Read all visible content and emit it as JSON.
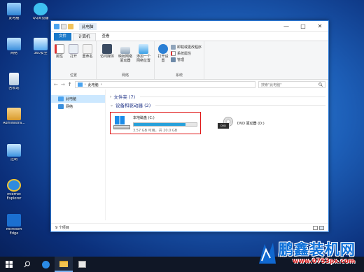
{
  "desktop": {
    "icons": [
      {
        "label": "此电脑",
        "color": "#4aa3ef"
      },
      {
        "label": "QQ浏览器",
        "color": "#3ec1f0"
      },
      {
        "label": "网络",
        "color": "#4aa3ef"
      },
      {
        "label": "360安全",
        "color": "#5bb6f2"
      },
      {
        "label": "回收站",
        "color": "#d9e6f2"
      },
      {
        "label": "Administra...",
        "color": "#e8b24a"
      },
      {
        "label": "控制",
        "color": "#5bb6f2"
      },
      {
        "label": "Internet Explorer",
        "color": "#2f8be0"
      },
      {
        "label": "Microsoft Edge",
        "color": "#1b6fd0"
      }
    ]
  },
  "window": {
    "title": "此电脑",
    "controls": {
      "minimize": "—",
      "maximize": "□",
      "close": "✕"
    }
  },
  "ribbon": {
    "tabs": [
      "文件",
      "计算机",
      "查看"
    ],
    "groups": [
      {
        "name": "位置",
        "buttons": [
          "属性",
          "打开",
          "重命名"
        ]
      },
      {
        "name": "网络",
        "buttons": [
          "访问媒体",
          "映射网络驱动器",
          "添加一个网络位置"
        ]
      },
      {
        "name": "系统",
        "open_settings": "打开设置",
        "items": [
          "卸载或更改程序",
          "系统属性",
          "管理"
        ]
      }
    ]
  },
  "address": {
    "nav_back": "←",
    "nav_forward": "→",
    "nav_up": "↑",
    "path": [
      "此电脑",
      "›"
    ],
    "search_placeholder": "搜索\"此电脑\"",
    "search_icon": "search-icon"
  },
  "navpane": {
    "items": [
      {
        "label": "此电脑",
        "selected": true
      },
      {
        "label": "网络",
        "selected": false
      }
    ]
  },
  "main": {
    "folders_header": "文件夹 (7)",
    "devices_header": "设备和驱动器 (2)",
    "drives": [
      {
        "name": "本地磁盘 (C:)",
        "used_fraction": 0.82,
        "detail": "3.57 GB 可用，共 20.0 GB",
        "highlighted": true
      },
      {
        "name": "DVD 驱动器 (D:)",
        "highlighted": false
      }
    ]
  },
  "statusbar": {
    "count": "9 个项目"
  },
  "watermark": {
    "title": "鹏鑫装机网",
    "url": "www.0753px.com"
  },
  "colors": {
    "accent": "#1979ca",
    "highlight_box": "#e01818",
    "drive_bar": "#26a0da"
  }
}
